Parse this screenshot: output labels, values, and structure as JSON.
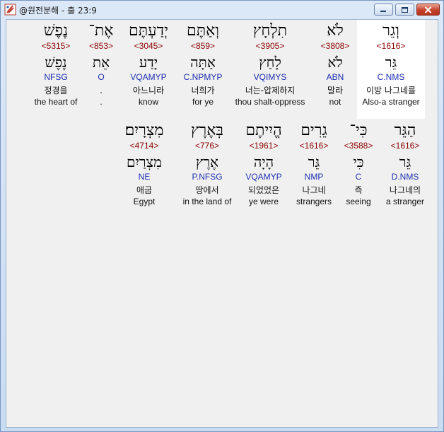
{
  "window": {
    "title": "@원전분해 - 출 23:9"
  },
  "rows": [
    {
      "words": [
        {
          "hebrew": "וְגֵר",
          "strong": "<1616>",
          "lemma": "גֵּר",
          "morph": "C.NMS",
          "korean": "이방 나그네를",
          "english": "Also-a stranger",
          "highlight": true
        },
        {
          "hebrew": "לֹא",
          "strong": "<3808>",
          "lemma": "לֹא",
          "morph": "ABN",
          "korean": "말라",
          "english": "not",
          "highlight": false
        },
        {
          "hebrew": "תִלְחָץ",
          "strong": "<3905>",
          "lemma": "לָחַץ",
          "morph": "VQIMYS",
          "korean": "너는-압제하지",
          "english": "thou shalt-oppress",
          "highlight": false
        },
        {
          "hebrew": "וְאַתֶּם",
          "strong": "<859>",
          "lemma": "אַתָּה",
          "morph": "C.NPMYP",
          "korean": "너희가",
          "english": "for ye",
          "highlight": false
        },
        {
          "hebrew": "יְדַעְתֶּם",
          "strong": "<3045>",
          "lemma": "יָדַע",
          "morph": "VQAMYP",
          "korean": "아느니라",
          "english": "know",
          "highlight": false
        },
        {
          "hebrew": "אֶת־",
          "strong": "<853>",
          "lemma": "אֵת",
          "morph": "O",
          "korean": ".",
          "english": ".",
          "highlight": false
        },
        {
          "hebrew": "נֶפֶשׁ",
          "strong": "<5315>",
          "lemma": "נֶפֶשׁ",
          "morph": "NFSG",
          "korean": "정경을",
          "english": "the heart of",
          "highlight": false
        }
      ]
    },
    {
      "words": [
        {
          "hebrew": "הַגֵּר",
          "strong": "<1616>",
          "lemma": "גֵּר",
          "morph": "D.NMS",
          "korean": "나그네의",
          "english": "a stranger",
          "highlight": false
        },
        {
          "hebrew": "כִּי־",
          "strong": "<3588>",
          "lemma": "כִּי",
          "morph": "C",
          "korean": "즉",
          "english": "seeing",
          "highlight": false
        },
        {
          "hebrew": "גֵרִים",
          "strong": "<1616>",
          "lemma": "גֵּר",
          "morph": "NMP",
          "korean": "나그네",
          "english": "strangers",
          "highlight": false
        },
        {
          "hebrew": "הֱיִיתֶם",
          "strong": "<1961>",
          "lemma": "הָיָה",
          "morph": "VQAMYP",
          "korean": "되었었은",
          "english": "ye were",
          "highlight": false
        },
        {
          "hebrew": "בְּאֶרֶץ",
          "strong": "<776>",
          "lemma": "אֶרֶץ",
          "morph": "P.NFSG",
          "korean": "땅에서",
          "english": "in the land of",
          "highlight": false
        },
        {
          "hebrew": "מִצְרָיִם׃",
          "strong": "<4714>",
          "lemma": "מִצְרַיִם",
          "morph": "NE",
          "korean": "애굽",
          "english": "Egypt",
          "highlight": false
        }
      ]
    }
  ]
}
